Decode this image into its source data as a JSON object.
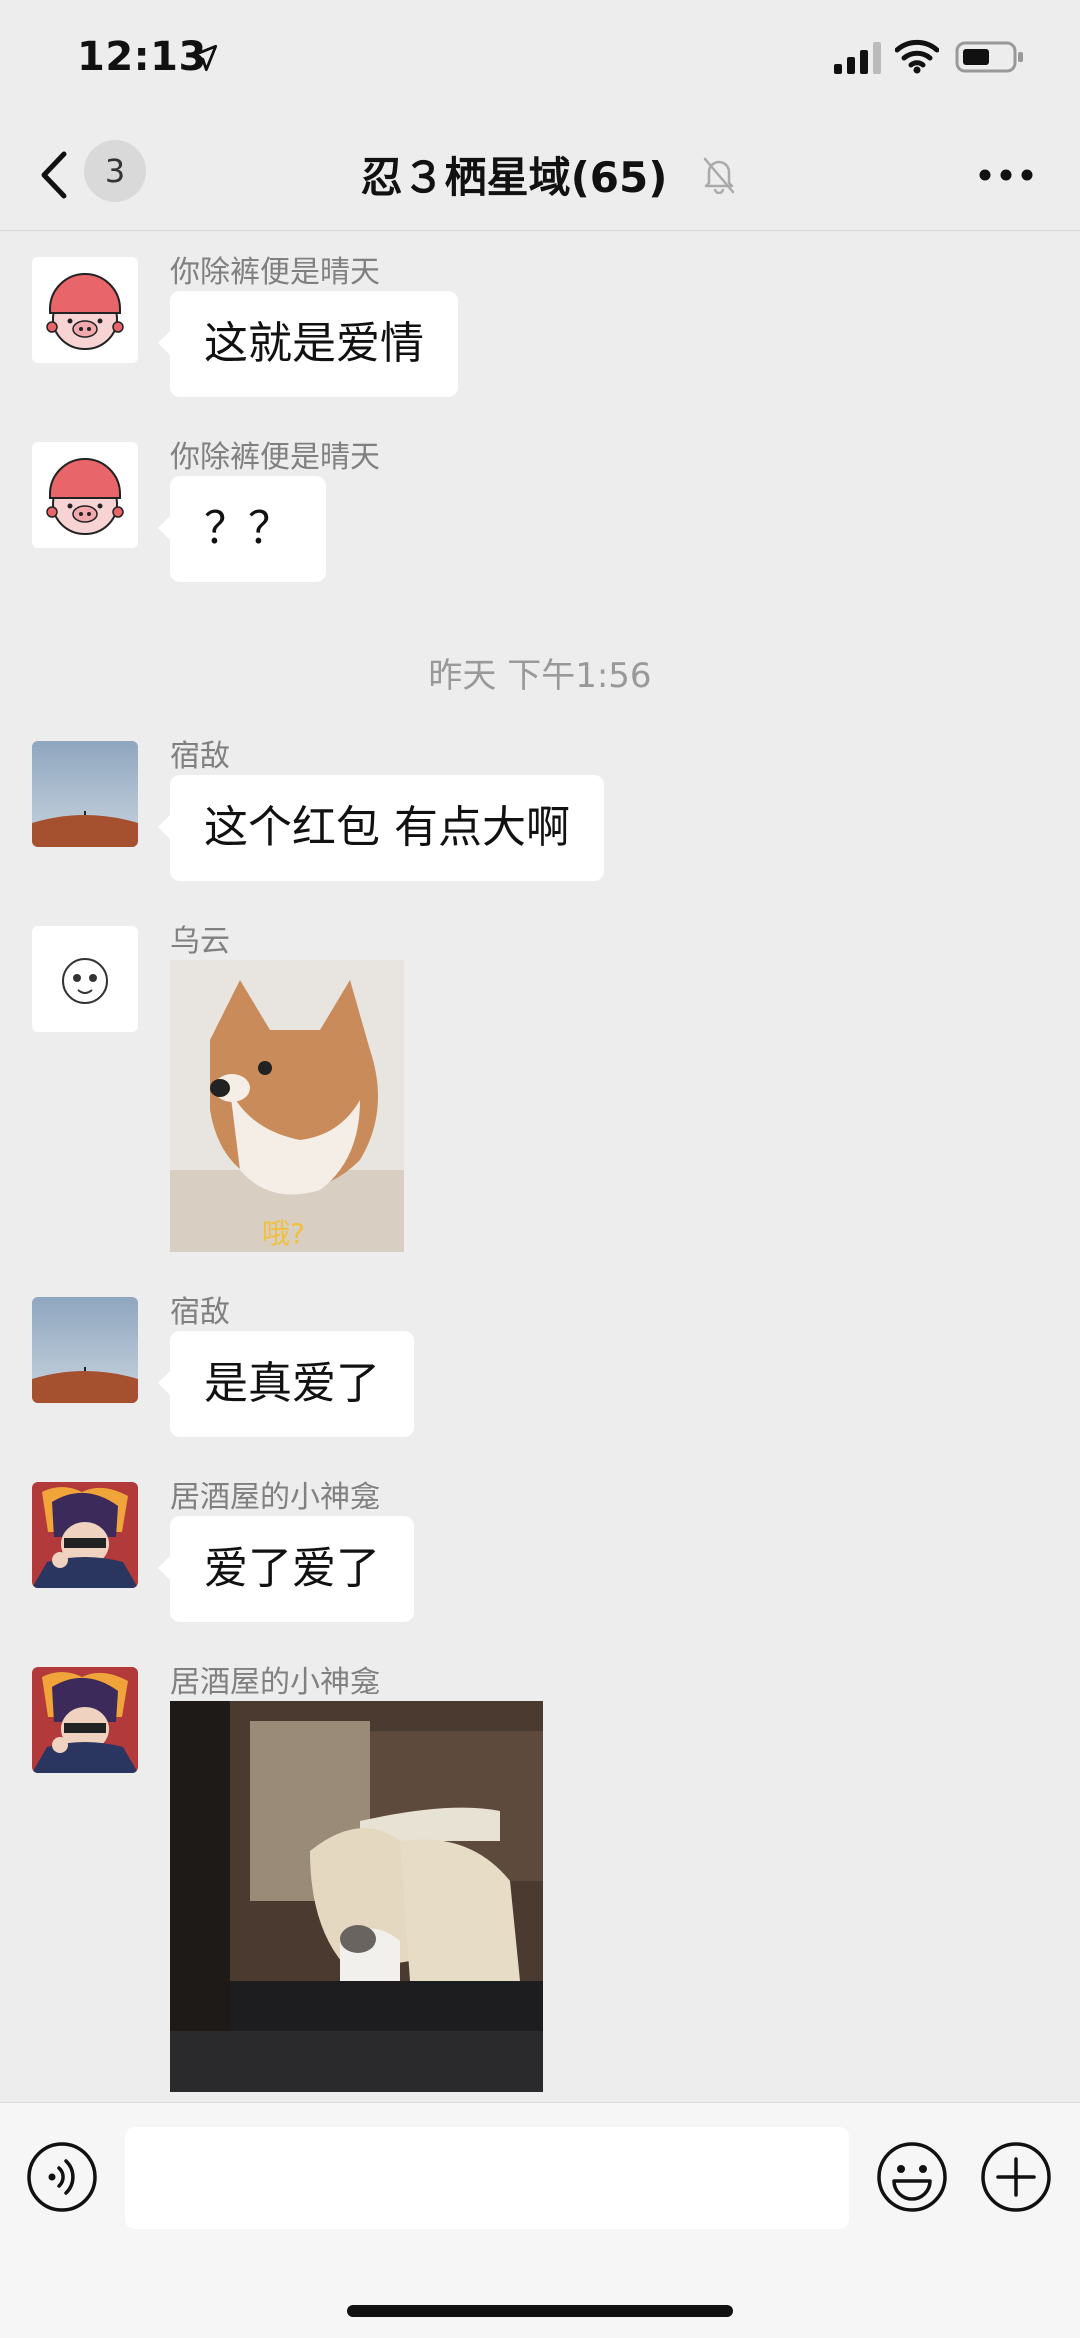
{
  "status_bar": {
    "time": "12:13",
    "location_icon": "location-arrow-icon",
    "signal_icon": "signal-bars-icon",
    "wifi_icon": "wifi-icon",
    "battery_icon": "battery-icon"
  },
  "header": {
    "back_icon": "chevron-left-icon",
    "unread_count": "3",
    "title": "忍３栖星域(65)",
    "mute_icon": "bell-muted-icon",
    "more_icon": "more-dots-icon"
  },
  "messages": [
    {
      "sender": "你除裤便是晴天",
      "text": "这就是爱情",
      "avatar": "pig-helmet-avatar"
    },
    {
      "sender": "你除裤便是晴天",
      "text": "？？",
      "avatar": "pig-helmet-avatar"
    },
    {
      "timestamp": "昨天 下午1:56"
    },
    {
      "sender": "宿敌",
      "text": "这个红包 有点大啊",
      "avatar": "desert-sky-avatar"
    },
    {
      "sender": "乌云",
      "image": "shiba-dog-sticker",
      "caption": "哦?",
      "avatar": "cartoon-face-avatar"
    },
    {
      "sender": "宿敌",
      "text": "是真爱了",
      "avatar": "desert-sky-avatar"
    },
    {
      "sender": "居酒屋的小神龛",
      "text": "爱了爱了",
      "avatar": "anime-character-avatar"
    },
    {
      "sender": "居酒屋的小神龛",
      "image": "dog-and-cat-gif",
      "avatar": "anime-character-avatar"
    }
  ],
  "input_bar": {
    "voice_icon": "voice-input-icon",
    "input_value": "",
    "emoji_icon": "emoji-smile-icon",
    "plus_icon": "plus-circle-icon"
  },
  "colors": {
    "background": "#ededed",
    "bubble": "#ffffff",
    "sender_text": "#808080"
  }
}
